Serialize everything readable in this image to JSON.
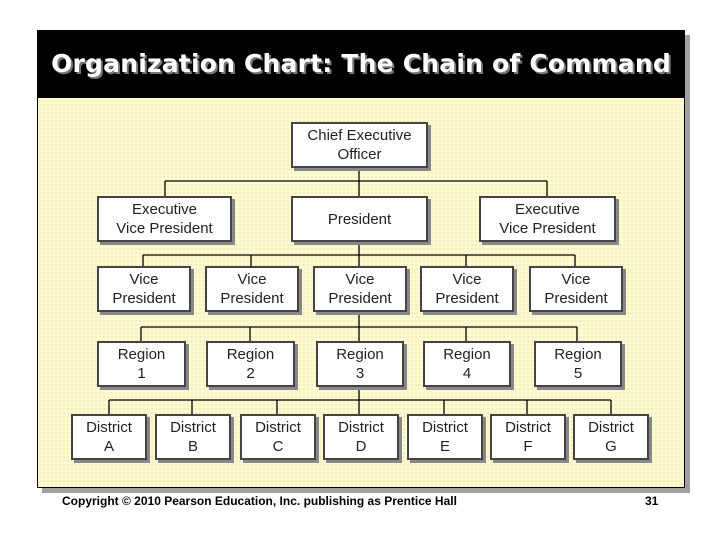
{
  "title": "Organization Chart: The Chain of Command",
  "org_chart": {
    "ceo": "Chief Executive\nOfficer",
    "level2": [
      "Executive\nVice President",
      "President",
      "Executive\nVice President"
    ],
    "level3": [
      "Vice\nPresident",
      "Vice\nPresident",
      "Vice\nPresident",
      "Vice\nPresident",
      "Vice\nPresident"
    ],
    "level4": [
      "Region\n1",
      "Region\n2",
      "Region\n3",
      "Region\n4",
      "Region\n5"
    ],
    "level5": [
      "District\nA",
      "District\nB",
      "District\nC",
      "District\nD",
      "District\nE",
      "District\nF",
      "District\nG"
    ]
  },
  "footer": {
    "copyright": "Copyright © 2010 Pearson Education, Inc. publishing as Prentice Hall",
    "page_number": "31"
  }
}
